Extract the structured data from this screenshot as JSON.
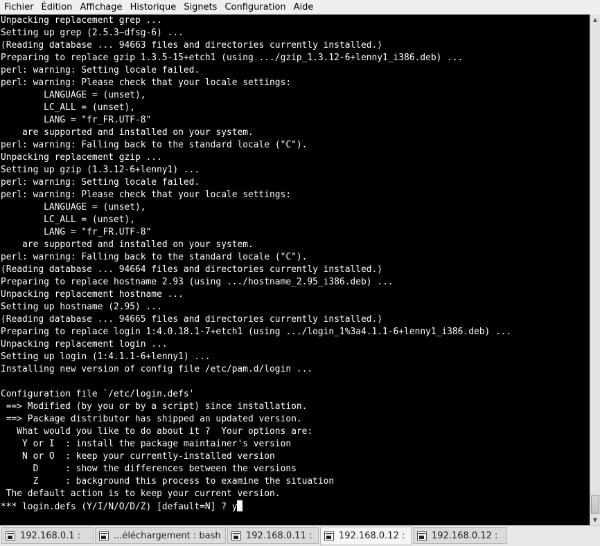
{
  "menubar": {
    "items": [
      "Fichier",
      "Édition",
      "Affichage",
      "Historique",
      "Signets",
      "Configuration",
      "Aide"
    ]
  },
  "terminal": {
    "lines": [
      "Unpacking replacement grep ...",
      "Setting up grep (2.5.3~dfsg-6) ...",
      "(Reading database ... 94663 files and directories currently installed.)",
      "Preparing to replace gzip 1.3.5-15+etch1 (using .../gzip_1.3.12-6+lenny1_i386.deb) ...",
      "perl: warning: Setting locale failed.",
      "perl: warning: Please check that your locale settings:",
      "        LANGUAGE = (unset),",
      "        LC_ALL = (unset),",
      "        LANG = \"fr_FR.UTF-8\"",
      "    are supported and installed on your system.",
      "perl: warning: Falling back to the standard locale (\"C\").",
      "Unpacking replacement gzip ...",
      "Setting up gzip (1.3.12-6+lenny1) ...",
      "perl: warning: Setting locale failed.",
      "perl: warning: Please check that your locale settings:",
      "        LANGUAGE = (unset),",
      "        LC_ALL = (unset),",
      "        LANG = \"fr_FR.UTF-8\"",
      "    are supported and installed on your system.",
      "perl: warning: Falling back to the standard locale (\"C\").",
      "(Reading database ... 94664 files and directories currently installed.)",
      "Preparing to replace hostname 2.93 (using .../hostname_2.95_i386.deb) ...",
      "Unpacking replacement hostname ...",
      "Setting up hostname (2.95) ...",
      "(Reading database ... 94665 files and directories currently installed.)",
      "Preparing to replace login 1:4.0.18.1-7+etch1 (using .../login_1%3a4.1.1-6+lenny1_i386.deb) ...",
      "Unpacking replacement login ...",
      "Setting up login (1:4.1.1-6+lenny1) ...",
      "Installing new version of config file /etc/pam.d/login ...",
      "",
      "Configuration file `/etc/login.defs'",
      " ==> Modified (by you or by a script) since installation.",
      " ==> Package distributor has shipped an updated version.",
      "   What would you like to do about it ?  Your options are:",
      "    Y or I  : install the package maintainer's version",
      "    N or O  : keep your currently-installed version",
      "      D     : show the differences between the versions",
      "      Z     : background this process to examine the situation",
      " The default action is to keep your current version."
    ],
    "prompt": "*** login.defs (Y/I/N/O/D/Z) [default=N] ? y"
  },
  "tabs": [
    {
      "label": "192.168.0.1 :"
    },
    {
      "label": "...éléchargement : bash"
    },
    {
      "label": "192.168.0.11 :"
    },
    {
      "label": "192.168.0.12 :"
    },
    {
      "label": "192.168.0.12 :"
    }
  ],
  "active_tab_index": 3
}
